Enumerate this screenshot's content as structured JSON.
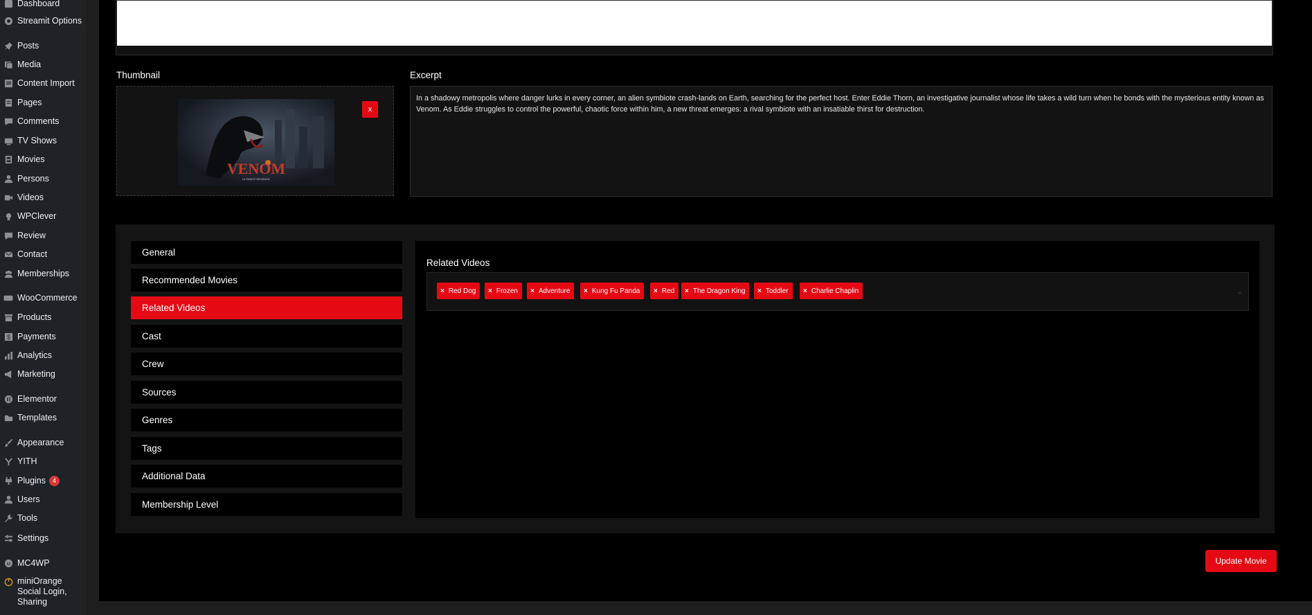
{
  "sidebar": {
    "items": [
      {
        "label": "Dashboard",
        "icon": "dashboard-icon"
      },
      {
        "label": "Streamit Options",
        "icon": "gear-circle-icon"
      },
      {
        "label": "Posts",
        "icon": "pin-icon"
      },
      {
        "label": "Media",
        "icon": "media-icon"
      },
      {
        "label": "Content Import",
        "icon": "import-icon"
      },
      {
        "label": "Pages",
        "icon": "pages-icon"
      },
      {
        "label": "Comments",
        "icon": "comment-icon"
      },
      {
        "label": "TV Shows",
        "icon": "tv-icon"
      },
      {
        "label": "Movies",
        "icon": "film-icon"
      },
      {
        "label": "Persons",
        "icon": "person-icon"
      },
      {
        "label": "Videos",
        "icon": "video-icon"
      },
      {
        "label": "WPClever",
        "icon": "bulb-icon"
      },
      {
        "label": "Review",
        "icon": "review-icon"
      },
      {
        "label": "Contact",
        "icon": "mail-icon"
      },
      {
        "label": "Memberships",
        "icon": "group-icon"
      },
      {
        "label": "WooCommerce",
        "icon": "woo-icon"
      },
      {
        "label": "Products",
        "icon": "archive-icon"
      },
      {
        "label": "Payments",
        "icon": "dollar-icon"
      },
      {
        "label": "Analytics",
        "icon": "bar-chart-icon"
      },
      {
        "label": "Marketing",
        "icon": "megaphone-icon"
      },
      {
        "label": "Elementor",
        "icon": "elementor-icon"
      },
      {
        "label": "Templates",
        "icon": "folder-icon"
      },
      {
        "label": "Appearance",
        "icon": "brush-icon"
      },
      {
        "label": "YITH",
        "icon": "yith-icon"
      },
      {
        "label": "Plugins",
        "icon": "plugin-icon",
        "badge": "4"
      },
      {
        "label": "Users",
        "icon": "user-icon"
      },
      {
        "label": "Tools",
        "icon": "wrench-icon"
      },
      {
        "label": "Settings",
        "icon": "settings-icon"
      },
      {
        "label": "MC4WP",
        "icon": "mc4wp-icon"
      },
      {
        "label": "miniOrange Social Login, Sharing",
        "icon": "miniorange-icon"
      }
    ]
  },
  "thumbnail": {
    "label": "Thumbnail",
    "image_alt": "VENOM poster",
    "poster_title": "VENOM",
    "poster_subtitle": "ULTIMATE REVENGE",
    "remove_label": "x"
  },
  "excerpt": {
    "label": "Excerpt",
    "text": "In a shadowy metropolis where danger lurks in every corner, an alien symbiote crash-lands on Earth, searching for the perfect host. Enter Eddie Thorn, an investigative journalist whose life takes a wild turn when he bonds with the mysterious entity known as Venom. As Eddie struggles to control the powerful, chaotic force within him, a new threat emerges: a rival symbiote with an insatiable thirst for destruction."
  },
  "tabs": [
    {
      "label": "General",
      "active": false
    },
    {
      "label": "Recommended Movies",
      "active": false
    },
    {
      "label": "Related Videos",
      "active": true
    },
    {
      "label": "Cast",
      "active": false
    },
    {
      "label": "Crew",
      "active": false
    },
    {
      "label": "Sources",
      "active": false
    },
    {
      "label": "Genres",
      "active": false
    },
    {
      "label": "Tags",
      "active": false
    },
    {
      "label": "Additional Data",
      "active": false
    },
    {
      "label": "Membership Level",
      "active": false
    }
  ],
  "related_videos": {
    "title": "Related Videos",
    "selected": [
      "Red Dog",
      "Frozen",
      "Adventure",
      "Kung Fu Panda",
      "Red",
      "The Dragon King",
      "Toddler",
      "Charlie Chaplin"
    ]
  },
  "actions": {
    "update_label": "Update Movie"
  },
  "colors": {
    "accent": "#e50914",
    "sidebar_bg": "#1d2327",
    "page_bg": "#000000"
  }
}
